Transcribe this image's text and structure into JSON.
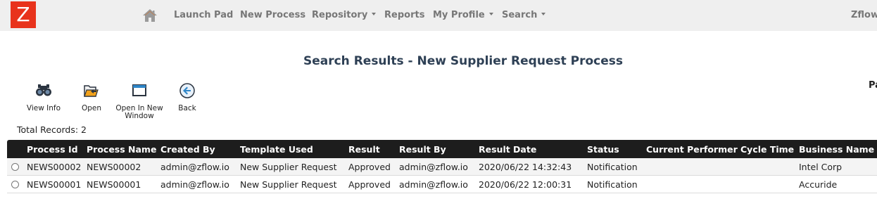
{
  "nav": {
    "logo": "Z",
    "items": [
      "Launch Pad",
      "New Process",
      "Repository",
      "Reports",
      "My Profile",
      "Search"
    ],
    "user": "Zflow"
  },
  "page": {
    "title": "Search Results - New Supplier Request Process",
    "side_label": "Pa"
  },
  "toolbar": {
    "view_info": "View Info",
    "open": "Open",
    "open_new_line1": "Open In New",
    "open_new_line2": "Window",
    "back": "Back"
  },
  "total_records": "Total Records: 2",
  "table": {
    "columns": [
      "Process Id",
      "Process Name",
      "Created By",
      "Template Used",
      "Result",
      "Result By",
      "Result Date",
      "Status",
      "Current Performer",
      "Cycle Time",
      "Business Name"
    ],
    "rows": [
      [
        "NEWS00002",
        "NEWS00002",
        "admin@zflow.io",
        "New Supplier Request",
        "Approved",
        "admin@zflow.io",
        "2020/06/22 14:32:43",
        "Notification",
        "",
        "",
        "Intel Corp"
      ],
      [
        "NEWS00001",
        "NEWS00001",
        "admin@zflow.io",
        "New Supplier Request",
        "Approved",
        "admin@zflow.io",
        "2020/06/22 12:00:31",
        "Notification",
        "",
        "",
        "Accuride"
      ]
    ]
  },
  "colors": {
    "logo_bg": "#e8331c",
    "nav_bg": "#efefef",
    "title": "#2e4055",
    "header_bg": "#1d1d1d"
  }
}
